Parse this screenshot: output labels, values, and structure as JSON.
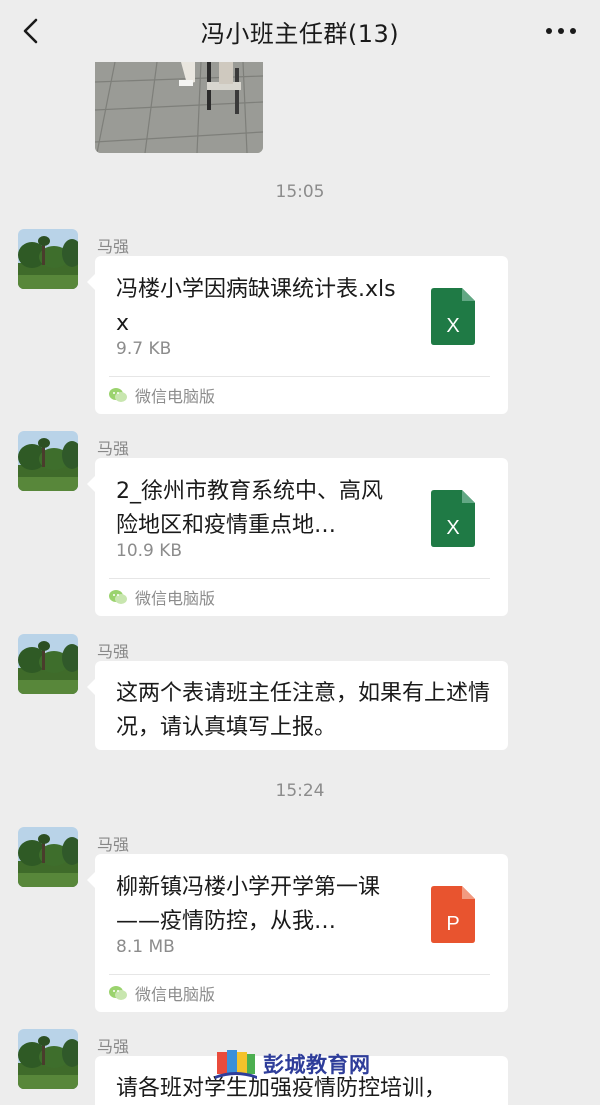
{
  "navbar": {
    "title": "冯小班主任群(13)",
    "back_icon": "chevron-left-icon",
    "more_icon": "more-dots-icon"
  },
  "messages": {
    "time_1": "15:05",
    "time_2": "15:24",
    "sender": "马强",
    "file1": {
      "name": "冯楼小学因病缺课统计表.xlsx",
      "size": "9.7 KB",
      "type": "X",
      "source": "微信电脑版"
    },
    "file2": {
      "name": "2_徐州市教育系统中、高风险地区和疫情重点地…",
      "size": "10.9 KB",
      "type": "X",
      "source": "微信电脑版"
    },
    "text1": "这两个表请班主任注意，如果有上述情况，请认真填写上报。",
    "file3": {
      "name": "柳新镇冯楼小学开学第一课——疫情防控，从我…",
      "size": "8.1 MB",
      "type": "P",
      "source": "微信电脑版"
    },
    "text2": "请各班对学生加强疫情防控培训，"
  },
  "watermark": {
    "text": "彭城教育网"
  },
  "colors": {
    "background": "#ededed",
    "excel_green": "#1f7a45",
    "ppt_orange": "#e8542f",
    "bubble": "#ffffff",
    "muted": "#8c8c8c"
  }
}
